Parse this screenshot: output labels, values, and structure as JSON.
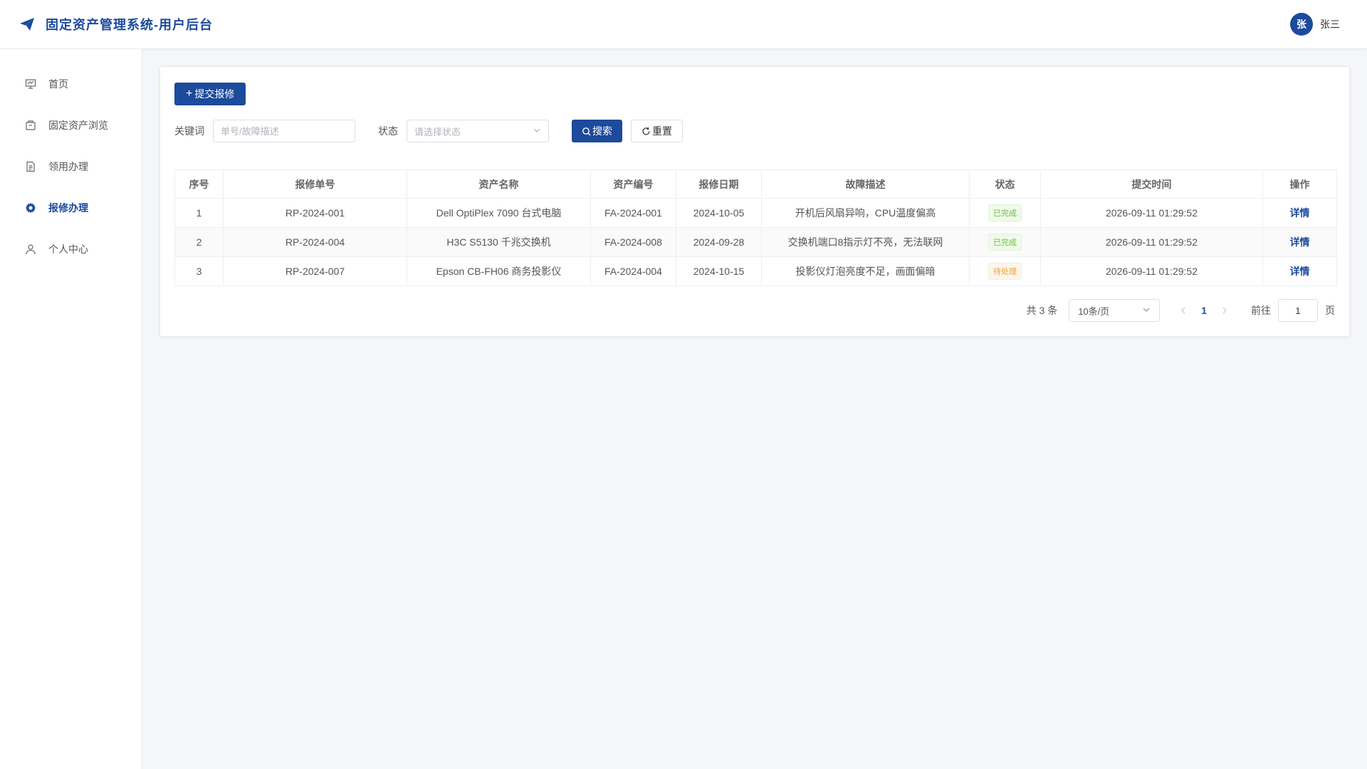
{
  "header": {
    "title": "固定资产管理系统-用户后台",
    "user_avatar": "张",
    "user_name": "张三"
  },
  "sidebar": {
    "items": [
      {
        "label": "首页",
        "icon": "presentation-icon"
      },
      {
        "label": "固定资产浏览",
        "icon": "box-icon"
      },
      {
        "label": "领用办理",
        "icon": "document-icon"
      },
      {
        "label": "报修办理",
        "icon": "gear-icon",
        "active": true
      },
      {
        "label": "个人中心",
        "icon": "user-icon"
      }
    ]
  },
  "toolbar": {
    "submit_label": "提交报修"
  },
  "filters": {
    "keyword_label": "关键词",
    "keyword_placeholder": "单号/故障描述",
    "status_label": "状态",
    "status_placeholder": "请选择状态",
    "search_label": "搜索",
    "reset_label": "重置"
  },
  "table": {
    "columns": [
      "序号",
      "报修单号",
      "资产名称",
      "资产编号",
      "报修日期",
      "故障描述",
      "状态",
      "提交时间",
      "操作"
    ],
    "rows": [
      {
        "index": "1",
        "repair_no": "RP-2024-001",
        "asset_name": "Dell OptiPlex 7090 台式电脑",
        "asset_no": "FA-2024-001",
        "date": "2024-10-05",
        "desc": "开机后风扇异响，CPU温度偏高",
        "status": "已完成",
        "status_type": "done",
        "submit_time": "2026-09-11 01:29:52",
        "action": "详情"
      },
      {
        "index": "2",
        "repair_no": "RP-2024-004",
        "asset_name": "H3C S5130 千兆交换机",
        "asset_no": "FA-2024-008",
        "date": "2024-09-28",
        "desc": "交换机端口8指示灯不亮，无法联网",
        "status": "已完成",
        "status_type": "done",
        "submit_time": "2026-09-11 01:29:52",
        "action": "详情"
      },
      {
        "index": "3",
        "repair_no": "RP-2024-007",
        "asset_name": "Epson CB-FH06 商务投影仪",
        "asset_no": "FA-2024-004",
        "date": "2024-10-15",
        "desc": "投影仪灯泡亮度不足，画面偏暗",
        "status": "待处理",
        "status_type": "pending",
        "submit_time": "2026-09-11 01:29:52",
        "action": "详情"
      }
    ]
  },
  "pagination": {
    "total_label": "共 3 条",
    "page_size": "10条/页",
    "current_page": "1",
    "goto_label": "前往",
    "goto_value": "1",
    "page_suffix": "页"
  },
  "colors": {
    "primary": "#1c4a9c",
    "success": "#67c23a",
    "warning": "#e6a23c"
  }
}
